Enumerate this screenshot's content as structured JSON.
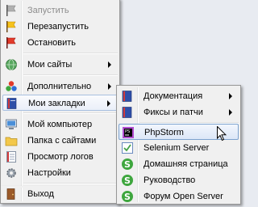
{
  "main_menu": {
    "items": [
      {
        "label": "Запустить",
        "icon": "flag-gray-icon",
        "disabled": true
      },
      {
        "label": "Перезапустить",
        "icon": "flag-yellow-icon"
      },
      {
        "label": "Остановить",
        "icon": "flag-red-icon"
      },
      {
        "label": "Мои сайты",
        "icon": "globe-icon",
        "submenu": true
      },
      {
        "label": "Дополнительно",
        "icon": "blocks-icon",
        "submenu": true
      },
      {
        "label": "Мои закладки",
        "icon": "bookmarks-icon",
        "submenu": true,
        "active": true
      },
      {
        "label": "Мой компьютер",
        "icon": "computer-icon"
      },
      {
        "label": "Папка с сайтами",
        "icon": "folder-icon"
      },
      {
        "label": "Просмотр логов",
        "icon": "log-icon"
      },
      {
        "label": "Настройки",
        "icon": "settings-icon"
      },
      {
        "label": "Выход",
        "icon": "exit-icon"
      }
    ]
  },
  "sub_menu": {
    "items": [
      {
        "label": "Документация",
        "icon": "book-icon",
        "submenu": true
      },
      {
        "label": "Фиксы и патчи",
        "icon": "book-icon",
        "submenu": true
      },
      {
        "label": "PhpStorm",
        "icon": "phpstorm-icon",
        "hover": true
      },
      {
        "label": "Selenium Server",
        "icon": "selenium-icon"
      },
      {
        "label": "Домашняя страница",
        "icon": "openserver-icon"
      },
      {
        "label": "Руководство",
        "icon": "openserver-icon"
      },
      {
        "label": "Форум Open Server",
        "icon": "openserver-icon"
      }
    ]
  },
  "colors": {
    "menu_bg": "#f0f0f0",
    "hover_border": "#a8c0e0",
    "open_server_green": "#3ea63e"
  }
}
